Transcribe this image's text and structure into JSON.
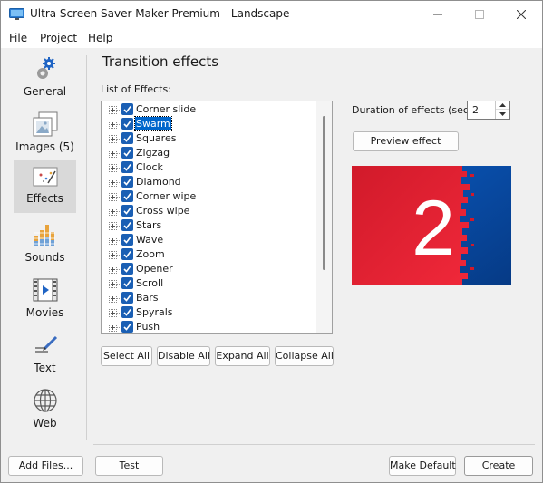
{
  "window": {
    "title": "Ultra Screen Saver Maker Premium - Landscape"
  },
  "menu": {
    "items": [
      "File",
      "Project",
      "Help"
    ]
  },
  "sidebar": {
    "items": [
      {
        "label": "General",
        "icon": "gear-icon"
      },
      {
        "label": "Images (5)",
        "icon": "images-icon"
      },
      {
        "label": "Effects",
        "icon": "effects-icon",
        "active": true
      },
      {
        "label": "Sounds",
        "icon": "sounds-icon"
      },
      {
        "label": "Movies",
        "icon": "movies-icon"
      },
      {
        "label": "Text",
        "icon": "text-icon"
      },
      {
        "label": "Web",
        "icon": "globe-icon"
      }
    ]
  },
  "main": {
    "title": "Transition effects",
    "list_label": "List of Effects:",
    "effects": [
      {
        "name": "Corner slide",
        "checked": true,
        "selected": false
      },
      {
        "name": "Swarm",
        "checked": true,
        "selected": true
      },
      {
        "name": "Squares",
        "checked": true,
        "selected": false
      },
      {
        "name": "Zigzag",
        "checked": true,
        "selected": false
      },
      {
        "name": "Clock",
        "checked": true,
        "selected": false
      },
      {
        "name": "Diamond",
        "checked": true,
        "selected": false
      },
      {
        "name": "Corner wipe",
        "checked": true,
        "selected": false
      },
      {
        "name": "Cross wipe",
        "checked": true,
        "selected": false
      },
      {
        "name": "Stars",
        "checked": true,
        "selected": false
      },
      {
        "name": "Wave",
        "checked": true,
        "selected": false
      },
      {
        "name": "Zoom",
        "checked": true,
        "selected": false
      },
      {
        "name": "Opener",
        "checked": true,
        "selected": false
      },
      {
        "name": "Scroll",
        "checked": true,
        "selected": false
      },
      {
        "name": "Bars",
        "checked": true,
        "selected": false
      },
      {
        "name": "Spyrals",
        "checked": true,
        "selected": false
      },
      {
        "name": "Push",
        "checked": true,
        "selected": false
      }
    ],
    "list_buttons": {
      "select_all": "Select All",
      "disable_all": "Disable All",
      "expand_all": "Expand All",
      "collapse_all": "Collapse All"
    },
    "duration_label": "Duration of effects (sec):",
    "duration_value": "2",
    "preview_button": "Preview effect",
    "preview_number": "2",
    "preview_colors": {
      "red": "#e01b2c",
      "blue": "#0b4aa3"
    }
  },
  "footer": {
    "add_files": "Add Files...",
    "test": "Test",
    "make_default": "Make Default",
    "create": "Create"
  },
  "colors": {
    "accent": "#0066cc",
    "checkbox": "#1a5fb4"
  }
}
